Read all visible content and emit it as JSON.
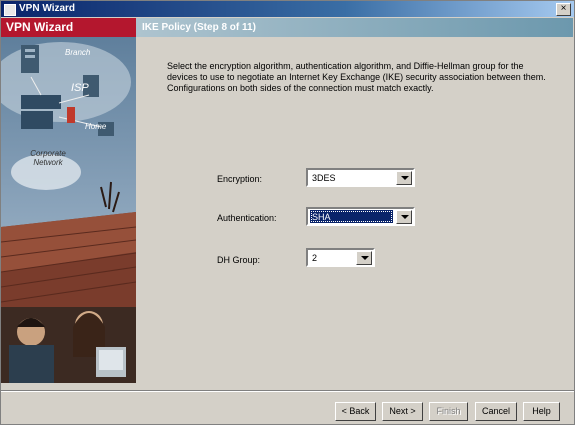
{
  "window": {
    "title": "VPN Wizard",
    "close_label": "×"
  },
  "sidebar": {
    "header": "VPN Wizard",
    "labels": {
      "branch": "Branch",
      "isp": "ISP",
      "home": "Home",
      "corporate": "Corporate\nNetwork"
    }
  },
  "step": {
    "title": "IKE Policy  (Step 8 of 11)"
  },
  "description": "Select the encryption algorithm, authentication algorithm, and Diffie-Hellman group for the devices to use to negotiate an Internet Key Exchange (IKE) security association between them. Configurations on both sides of the connection must match exactly.",
  "form": {
    "encryption": {
      "label": "Encryption:",
      "value": "3DES"
    },
    "authentication": {
      "label": "Authentication:",
      "value": "SHA"
    },
    "dh_group": {
      "label": "DH Group:",
      "value": "2"
    }
  },
  "buttons": {
    "back": "< Back",
    "next": "Next >",
    "finish": "Finish",
    "cancel": "Cancel",
    "help": "Help"
  },
  "colors": {
    "sidebar_header": "#b4172e",
    "title_bar": "#0a246a",
    "step_header": "#6c98ad"
  }
}
